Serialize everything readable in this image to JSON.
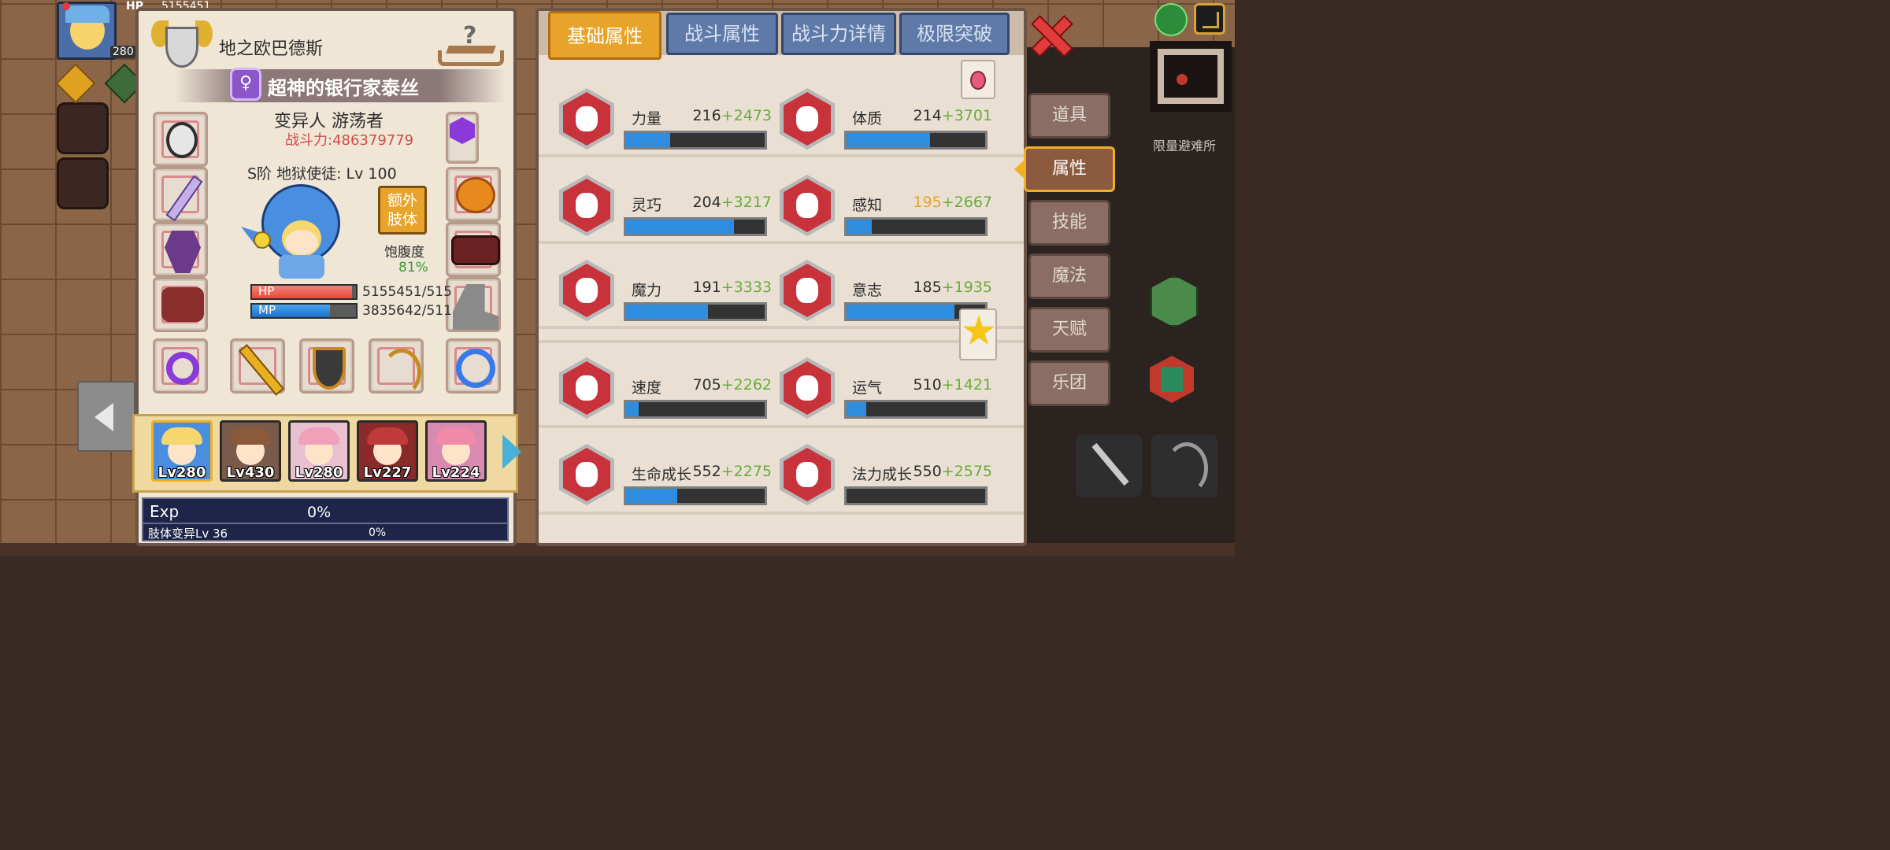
{
  "top_hud": {
    "hp_label": "HP",
    "hp_value": "5155451",
    "player_level": "280",
    "map_side_text": "限量避难所"
  },
  "character": {
    "region": "地之欧巴德斯",
    "title": "超神的银行家泰丝",
    "race_class": "变异人 游荡者",
    "combat_power": "战斗力:486379779",
    "rank_level": "S阶 地狱使徒: Lv 100",
    "extra_limb_button": "额外\n肢体",
    "satiety_label": "饱腹度",
    "satiety_value": "81%",
    "hp_label": "HP",
    "hp_value": "5155451/515",
    "hp_ratio": 0.96,
    "mp_label": "MP",
    "mp_value": "3835642/511",
    "mp_ratio": 0.75
  },
  "party": [
    {
      "level": "Lv280",
      "selected": true
    },
    {
      "level": "Lv430",
      "selected": false
    },
    {
      "level": "Lv280",
      "selected": false
    },
    {
      "level": "Lv227",
      "selected": false
    },
    {
      "level": "Lv224",
      "selected": false
    }
  ],
  "exp": {
    "label": "Exp",
    "value": "0%",
    "sub_label": "肢体变异Lv 36",
    "sub_value": "0%"
  },
  "tabs": [
    "基础属性",
    "战斗属性",
    "战斗力详情",
    "极限突破"
  ],
  "active_tab": 0,
  "stats": [
    {
      "label": "力量",
      "base": "216",
      "bonus": "+2473",
      "fill": 0.32,
      "icon": "strength-icon"
    },
    {
      "label": "体质",
      "base": "214",
      "bonus": "+3701",
      "fill": 0.6,
      "icon": "constitution-icon"
    },
    {
      "label": "灵巧",
      "base": "204",
      "bonus": "+3217",
      "fill": 0.78,
      "icon": "agility-icon"
    },
    {
      "label": "感知",
      "base": "195",
      "bonus": "+2667",
      "fill": 0.18,
      "icon": "perception-icon",
      "base_highlight": true
    },
    {
      "label": "魔力",
      "base": "191",
      "bonus": "+3333",
      "fill": 0.59,
      "icon": "magic-icon"
    },
    {
      "label": "意志",
      "base": "185",
      "bonus": "+1935",
      "fill": 0.78,
      "icon": "will-icon"
    },
    {
      "label": "速度",
      "base": "705",
      "bonus": "+2262",
      "fill": 0.09,
      "icon": "speed-icon"
    },
    {
      "label": "运气",
      "base": "510",
      "bonus": "+1421",
      "fill": 0.14,
      "icon": "luck-icon"
    },
    {
      "label": "生命成长",
      "base": "552",
      "bonus": "+2275",
      "fill": 0.37,
      "icon": "life-growth-icon"
    },
    {
      "label": "法力成长",
      "base": "550",
      "bonus": "+2575",
      "fill": 0.0,
      "icon": "mana-growth-icon"
    }
  ],
  "side_menu": [
    "道具",
    "属性",
    "技能",
    "魔法",
    "天赋",
    "乐团"
  ],
  "active_side": 1,
  "colors": {
    "accent_tab": "#e8a32a",
    "bar_fill": "#2f8de0",
    "bonus_green": "#6aab3a",
    "power_red": "#d24a4a"
  }
}
